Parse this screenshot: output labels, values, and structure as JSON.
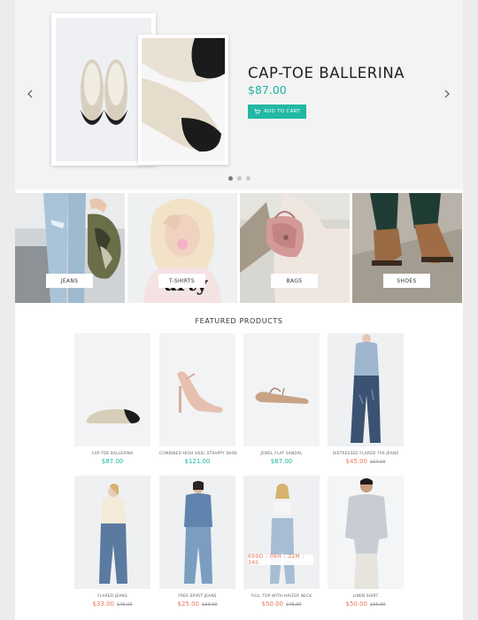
{
  "hero": {
    "title": "CAP-TOE BALLERINA",
    "price": "$87.00",
    "add_to_cart_label": "ADD TO CART",
    "prev_icon": "chevron-left-icon",
    "next_icon": "chevron-right-icon",
    "slide_count": 3,
    "active_slide": 1
  },
  "categories": [
    {
      "label": "JEANS"
    },
    {
      "label": "T-SHIRTS"
    },
    {
      "label": "BAGS"
    },
    {
      "label": "SHOES"
    }
  ],
  "featured": {
    "title": "FEATURED PRODUCTS",
    "products": [
      {
        "name": "CAP-TOE BALLERINA",
        "price": "$87.00",
        "old_price": "",
        "sale": false
      },
      {
        "name": "COMBINED HIGH HEEL STRAPPY SHOE",
        "price": "$121.00",
        "old_price": "",
        "sale": false
      },
      {
        "name": "JEWEL FLAT SANDAL",
        "price": "$87.00",
        "old_price": "",
        "sale": false
      },
      {
        "name": "DISTRESSED FLARED 70S JEANS",
        "price": "$45.00",
        "old_price": "$57.00",
        "sale": true
      },
      {
        "name": "FLARED JEANS",
        "price": "$33.00",
        "old_price": "$45.00",
        "sale": true
      },
      {
        "name": "FREE SPIRIT JEANS",
        "price": "$25.00",
        "old_price": "$33.00",
        "sale": true
      },
      {
        "name": "FULL TOP WITH HALTER NECK",
        "price": "$50.00",
        "old_price": "$78.00",
        "sale": true,
        "timer": "699D : 06H : 32M : 34S"
      },
      {
        "name": "LINEN SHIRT",
        "price": "$50.00",
        "old_price": "$65.00",
        "sale": true
      }
    ]
  },
  "colors": {
    "accent": "#22b8a5",
    "sale": "#e8795f",
    "background": "#ececec"
  }
}
